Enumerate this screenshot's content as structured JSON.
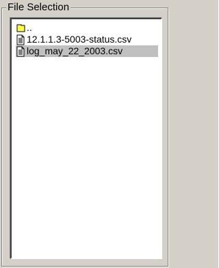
{
  "group": {
    "title": "File Selection"
  },
  "files": [
    {
      "label": "..",
      "icon": "folder-icon",
      "selected": false
    },
    {
      "label": "12.1.1.3-5003-status.csv",
      "icon": "file-icon",
      "selected": false
    },
    {
      "label": "log_may_22_2003.csv",
      "icon": "file-icon",
      "selected": true
    }
  ],
  "colors": {
    "background": "#d4d0c8",
    "selection": "#c0c0c0",
    "folder": "#ffff80"
  }
}
